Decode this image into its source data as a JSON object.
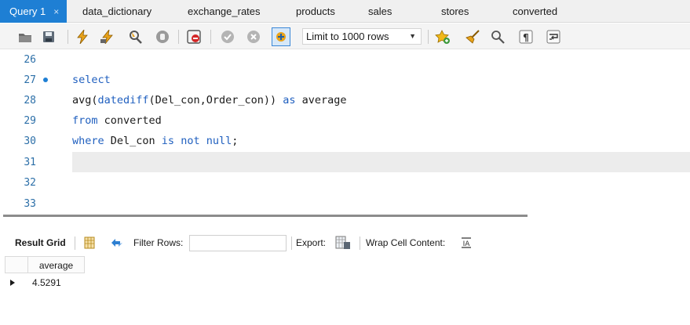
{
  "tabs": [
    {
      "label": "Query 1",
      "active": true,
      "close_glyph": "×"
    },
    {
      "label": "data_dictionary"
    },
    {
      "label": "exchange_rates"
    },
    {
      "label": "products"
    },
    {
      "label": "sales"
    },
    {
      "label": "stores"
    },
    {
      "label": "converted"
    }
  ],
  "toolbar": {
    "icons": [
      "open-folder-icon",
      "save-icon",
      "execute-lightning-icon",
      "execute-current-lightning-icon",
      "explain-magnifier-icon",
      "stop-icon",
      "toggle-error-stop-icon",
      "commit-check-icon",
      "rollback-x-icon",
      "autocommit-toggle-icon",
      "bookmark-star-icon",
      "beautify-broom-icon",
      "find-icon",
      "invisible-chars-icon",
      "wrap-lines-icon"
    ],
    "limit_label": "Limit to 1000 rows"
  },
  "editor": {
    "lines": [
      {
        "num": "26",
        "code": ""
      },
      {
        "num": "27",
        "code": "select",
        "marker": true
      },
      {
        "num": "28",
        "code": "avg(datediff(Del_con,Order_con)) as average"
      },
      {
        "num": "29",
        "code": "from converted"
      },
      {
        "num": "30",
        "code": "where Del_con is not null;"
      },
      {
        "num": "31",
        "code": "",
        "current": true
      },
      {
        "num": "32",
        "code": ""
      },
      {
        "num": "33",
        "code": ""
      }
    ],
    "tokens": {
      "l27_select": "select",
      "l28_avg": "avg(",
      "l28_datediff": "datediff",
      "l28_args": "(Del_con,Order_con)) ",
      "l28_as": "as",
      "l28_alias": " average",
      "l29_from": "from",
      "l29_table": " converted",
      "l30_where": "where",
      "l30_col": " Del_con ",
      "l30_is": "is",
      "l30_sp1": " ",
      "l30_not": "not",
      "l30_sp2": " ",
      "l30_null": "null",
      "l30_end": ";"
    }
  },
  "results": {
    "result_grid_label": "Result Grid",
    "filter_label": "Filter Rows:",
    "filter_value": "",
    "export_label": "Export:",
    "wrap_label": "Wrap Cell Content:",
    "columns": [
      "average"
    ],
    "rows": [
      [
        "4.5291"
      ]
    ]
  },
  "colors": {
    "active_tab": "#1e7fd4",
    "keyword": "#1f5fbf",
    "line_number": "#2c6fa8"
  }
}
